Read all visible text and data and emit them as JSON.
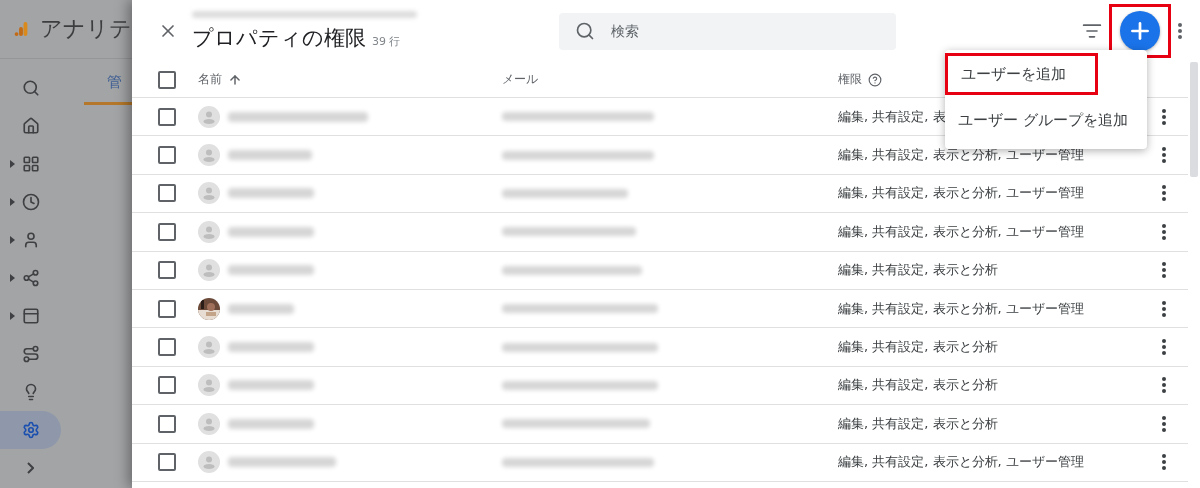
{
  "app": {
    "title": "アナリテ",
    "tab": "管"
  },
  "sidebar": {
    "items": [
      {
        "expandable": false,
        "selected": false
      },
      {
        "expandable": false,
        "selected": false
      },
      {
        "expandable": true,
        "selected": false
      },
      {
        "expandable": true,
        "selected": false
      },
      {
        "expandable": true,
        "selected": false
      },
      {
        "expandable": true,
        "selected": false
      },
      {
        "expandable": true,
        "selected": false
      },
      {
        "expandable": false,
        "selected": false
      },
      {
        "expandable": false,
        "selected": false
      },
      {
        "expandable": false,
        "selected": true
      },
      {
        "expandable": false,
        "selected": false
      }
    ]
  },
  "panel": {
    "title": "プロパティの権限",
    "count": "39 行",
    "search": {
      "placeholder": "検索"
    },
    "add_button": {
      "highlighted": true
    },
    "menu": [
      {
        "label": "ユーザーを追加",
        "highlighted": true
      },
      {
        "label": "ユーザー グループを追加",
        "highlighted": false
      }
    ],
    "table": {
      "columns": [
        "名前",
        "メール",
        "権限"
      ],
      "all_checked": false,
      "rows": [
        {
          "checked": false,
          "has_photo": false,
          "permissions": "編集, 共有設定, 表"
        },
        {
          "checked": false,
          "has_photo": false,
          "permissions": "編集, 共有設定, 表示と分析, ユーザー管理"
        },
        {
          "checked": false,
          "has_photo": false,
          "permissions": "編集, 共有設定, 表示と分析, ユーザー管理"
        },
        {
          "checked": false,
          "has_photo": false,
          "permissions": "編集, 共有設定, 表示と分析, ユーザー管理"
        },
        {
          "checked": false,
          "has_photo": false,
          "permissions": "編集, 共有設定, 表示と分析"
        },
        {
          "checked": false,
          "has_photo": true,
          "permissions": "編集, 共有設定, 表示と分析, ユーザー管理"
        },
        {
          "checked": false,
          "has_photo": false,
          "permissions": "編集, 共有設定, 表示と分析"
        },
        {
          "checked": false,
          "has_photo": false,
          "permissions": "編集, 共有設定, 表示と分析"
        },
        {
          "checked": false,
          "has_photo": false,
          "permissions": "編集, 共有設定, 表示と分析"
        },
        {
          "checked": false,
          "has_photo": false,
          "permissions": "編集, 共有設定, 表示と分析, ユーザー管理"
        }
      ]
    }
  }
}
